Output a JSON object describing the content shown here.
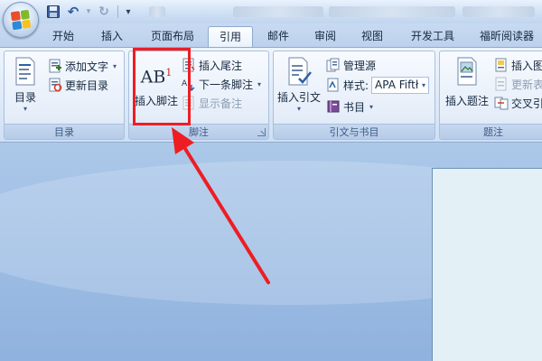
{
  "quick_access": {
    "icons": [
      "save-icon",
      "undo-icon",
      "redo-icon",
      "customize-qat-icon"
    ],
    "undo_glyph": "↶",
    "redo_glyph": "↻",
    "dropdown_glyph": "▾"
  },
  "tabs": [
    {
      "label": "开始",
      "active": false
    },
    {
      "label": "插入",
      "active": false
    },
    {
      "label": "页面布局",
      "active": false
    },
    {
      "label": "引用",
      "active": true
    },
    {
      "label": "邮件",
      "active": false
    },
    {
      "label": "审阅",
      "active": false
    },
    {
      "label": "视图",
      "active": false
    },
    {
      "label": "开发工具",
      "active": false
    },
    {
      "label": "福昕阅读器",
      "active": false
    }
  ],
  "ribbon": {
    "toc_group": {
      "label": "目录",
      "toc_button": "目录",
      "add_text": "添加文字",
      "update_toc": "更新目录"
    },
    "footnotes_group": {
      "label": "脚注",
      "insert_footnote": "插入脚注",
      "icon_text": "AB",
      "icon_superscript": "1",
      "insert_endnote": "插入尾注",
      "next_footnote": "下一条脚注",
      "show_notes": "显示备注"
    },
    "citations_group": {
      "label": "引文与书目",
      "insert_citation": "插入引文",
      "manage_sources": "管理源",
      "style_label": "样式:",
      "style_value": "APA Fiftł",
      "bibliography": "书目"
    },
    "captions_group": {
      "label": "题注",
      "insert_caption": "插入题注",
      "insert_table_of_figures": "插入图",
      "update_table": "更新表",
      "cross_reference": "交叉引"
    }
  },
  "colors": {
    "annotation_red": "#ee1d23",
    "ribbon_border": "#a8c0e0",
    "page": "#e3f1f7"
  }
}
